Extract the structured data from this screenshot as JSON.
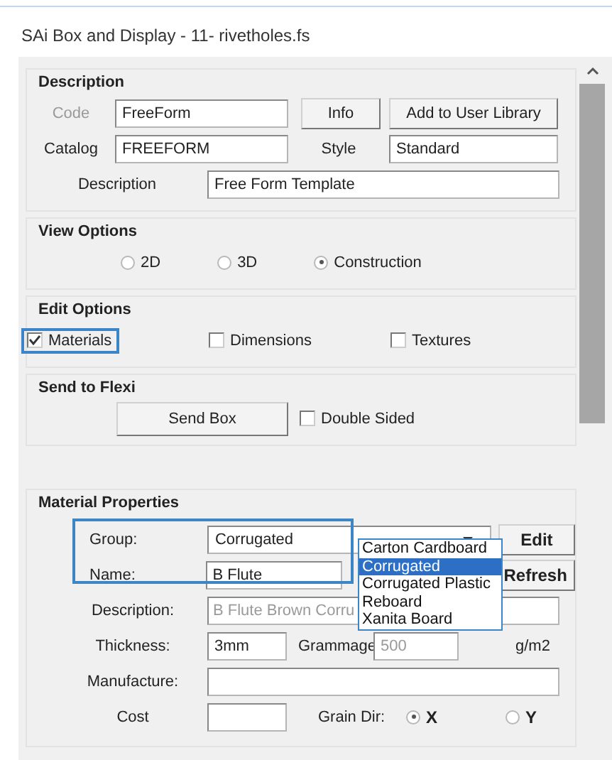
{
  "window": {
    "title": "SAi Box and Display - 11- rivetholes.fs"
  },
  "description": {
    "title": "Description",
    "code": {
      "label": "Code",
      "value": "FreeForm",
      "disabled": true
    },
    "info_button": "Info",
    "add_button": "Add to User Library",
    "catalog": {
      "label": "Catalog",
      "value": "FREEFORM"
    },
    "style": {
      "label": "Style",
      "value": "Standard"
    },
    "description": {
      "label": "Description",
      "value": "Free Form Template"
    }
  },
  "view_options": {
    "title": "View Options",
    "radios": [
      {
        "label": "2D",
        "selected": false
      },
      {
        "label": "3D",
        "selected": false
      },
      {
        "label": "Construction",
        "selected": true
      }
    ]
  },
  "edit_options": {
    "title": "Edit Options",
    "checkboxes": [
      {
        "label": "Materials",
        "checked": true,
        "focused": true
      },
      {
        "label": "Dimensions",
        "checked": false,
        "focused": false
      },
      {
        "label": "Textures",
        "checked": false,
        "focused": false
      }
    ]
  },
  "send_to_flexi": {
    "title": "Send to Flexi",
    "button": "Send Box",
    "checkbox": {
      "label": "Double Sided",
      "checked": false
    }
  },
  "material_properties": {
    "title": "Material Properties",
    "group": {
      "label": "Group:",
      "value": "Corrugated"
    },
    "name": {
      "label": "Name:",
      "value": "B Flute"
    },
    "dropdown": {
      "options": [
        {
          "label": "Carton Cardboard",
          "selected": false
        },
        {
          "label": "Corrugated",
          "selected": true
        },
        {
          "label": "Corrugated Plastic",
          "selected": false
        },
        {
          "label": "Reboard",
          "selected": false
        },
        {
          "label": "Xanita Board",
          "selected": false
        }
      ]
    },
    "edit_button": "Edit",
    "refresh_button": "Refresh",
    "description": {
      "label": "Description:",
      "value": "B Flute Brown Corru",
      "disabled": true
    },
    "thickness": {
      "label": "Thickness:",
      "value": "3mm"
    },
    "grammage": {
      "label": "Grammage",
      "value": "500",
      "unit": "g/m2",
      "disabled": true
    },
    "manufacture": {
      "label": "Manufacture:"
    },
    "cost": {
      "label": "Cost"
    },
    "grain_dir": {
      "label": "Grain Dir:",
      "options": [
        {
          "label": "X",
          "selected": true
        },
        {
          "label": "Y",
          "selected": false
        }
      ]
    }
  }
}
